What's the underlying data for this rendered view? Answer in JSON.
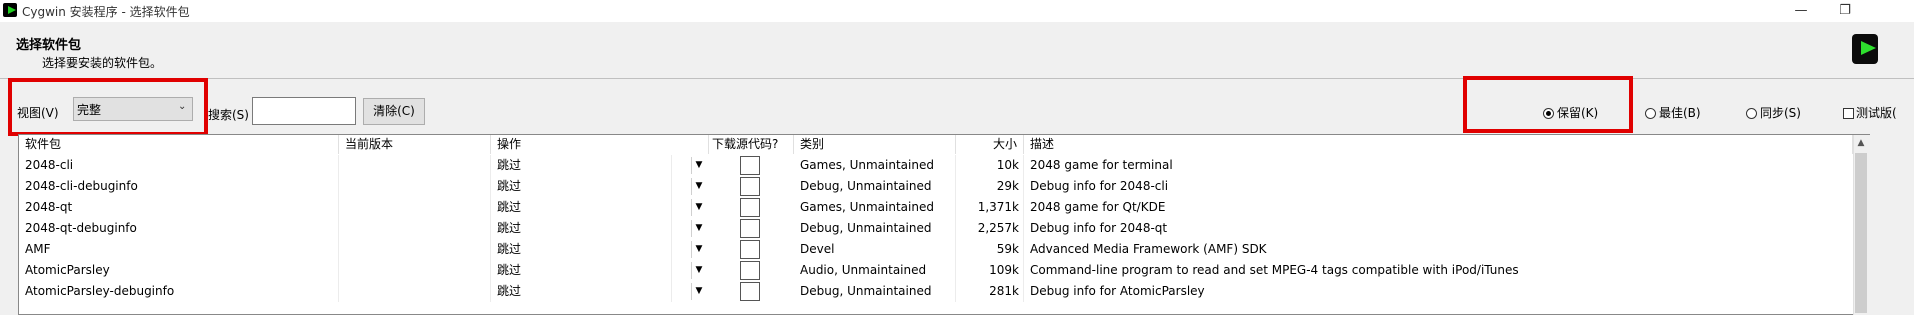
{
  "window": {
    "title": "Cygwin 安装程序 - 选择软件包",
    "minimize": "—",
    "restore": "❐"
  },
  "header": {
    "title": "选择软件包",
    "subtitle": "选择要安装的软件包。",
    "logo_icon": "cygwin-logo-icon"
  },
  "toolbar": {
    "view_label": "视图(V)",
    "view_value": "完整",
    "search_label": "搜索(S)",
    "search_value": "",
    "clear_label": "清除(C)",
    "radio_keep": "保留(K)",
    "radio_best": "最佳(B)",
    "radio_sync": "同步(S)",
    "test_label": "测试版(",
    "selected_radio": "keep"
  },
  "table": {
    "columns": {
      "name": "软件包",
      "current": "当前版本",
      "action": "操作",
      "source": "下载源代码?",
      "category": "类别",
      "size": "大小",
      "desc": "描述"
    },
    "rows": [
      {
        "name": "2048-cli",
        "current": "",
        "action": "跳过",
        "category": "Games, Unmaintained",
        "size": "10k",
        "desc": "2048 game for terminal"
      },
      {
        "name": "2048-cli-debuginfo",
        "current": "",
        "action": "跳过",
        "category": "Debug, Unmaintained",
        "size": "29k",
        "desc": "Debug info for 2048-cli"
      },
      {
        "name": "2048-qt",
        "current": "",
        "action": "跳过",
        "category": "Games, Unmaintained",
        "size": "1,371k",
        "desc": "2048 game for Qt/KDE"
      },
      {
        "name": "2048-qt-debuginfo",
        "current": "",
        "action": "跳过",
        "category": "Debug, Unmaintained",
        "size": "2,257k",
        "desc": "Debug info for 2048-qt"
      },
      {
        "name": "AMF",
        "current": "",
        "action": "跳过",
        "category": "Devel",
        "size": "59k",
        "desc": "Advanced Media Framework (AMF) SDK"
      },
      {
        "name": "AtomicParsley",
        "current": "",
        "action": "跳过",
        "category": "Audio, Unmaintained",
        "size": "109k",
        "desc": "Command-line program to read and set MPEG-4 tags compatible with iPod/iTunes"
      },
      {
        "name": "AtomicParsley-debuginfo",
        "current": "",
        "action": "跳过",
        "category": "Debug, Unmaintained",
        "size": "281k",
        "desc": "Debug info for AtomicParsley"
      }
    ]
  }
}
